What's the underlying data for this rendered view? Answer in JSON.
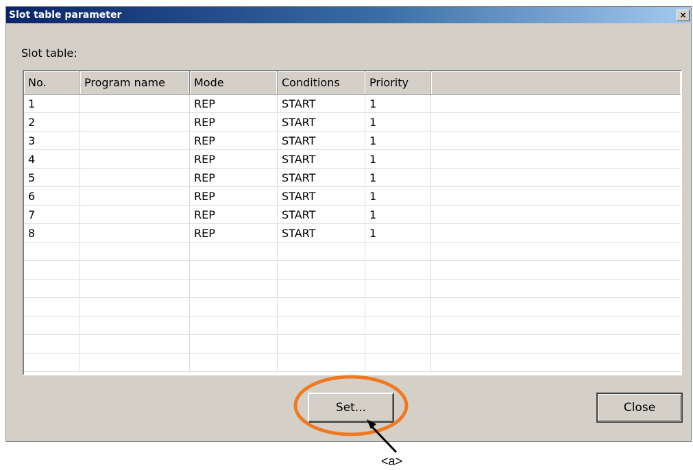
{
  "window": {
    "title": "Slot table parameter",
    "close_glyph": "×"
  },
  "section_label": "Slot table:",
  "table": {
    "columns": [
      "No.",
      "Program name",
      "Mode",
      "Conditions",
      "Priority"
    ],
    "rows": [
      {
        "no": "1",
        "program": "",
        "mode": "REP",
        "conditions": "START",
        "priority": "1"
      },
      {
        "no": "2",
        "program": "",
        "mode": "REP",
        "conditions": "START",
        "priority": "1"
      },
      {
        "no": "3",
        "program": "",
        "mode": "REP",
        "conditions": "START",
        "priority": "1"
      },
      {
        "no": "4",
        "program": "",
        "mode": "REP",
        "conditions": "START",
        "priority": "1"
      },
      {
        "no": "5",
        "program": "",
        "mode": "REP",
        "conditions": "START",
        "priority": "1"
      },
      {
        "no": "6",
        "program": "",
        "mode": "REP",
        "conditions": "START",
        "priority": "1"
      },
      {
        "no": "7",
        "program": "",
        "mode": "REP",
        "conditions": "START",
        "priority": "1"
      },
      {
        "no": "8",
        "program": "",
        "mode": "REP",
        "conditions": "START",
        "priority": "1"
      }
    ],
    "empty_rows": 7
  },
  "buttons": {
    "set_label": "Set...",
    "close_label": "Close"
  },
  "annotation": {
    "label": "<a>",
    "highlight_color": "#f07a21"
  }
}
